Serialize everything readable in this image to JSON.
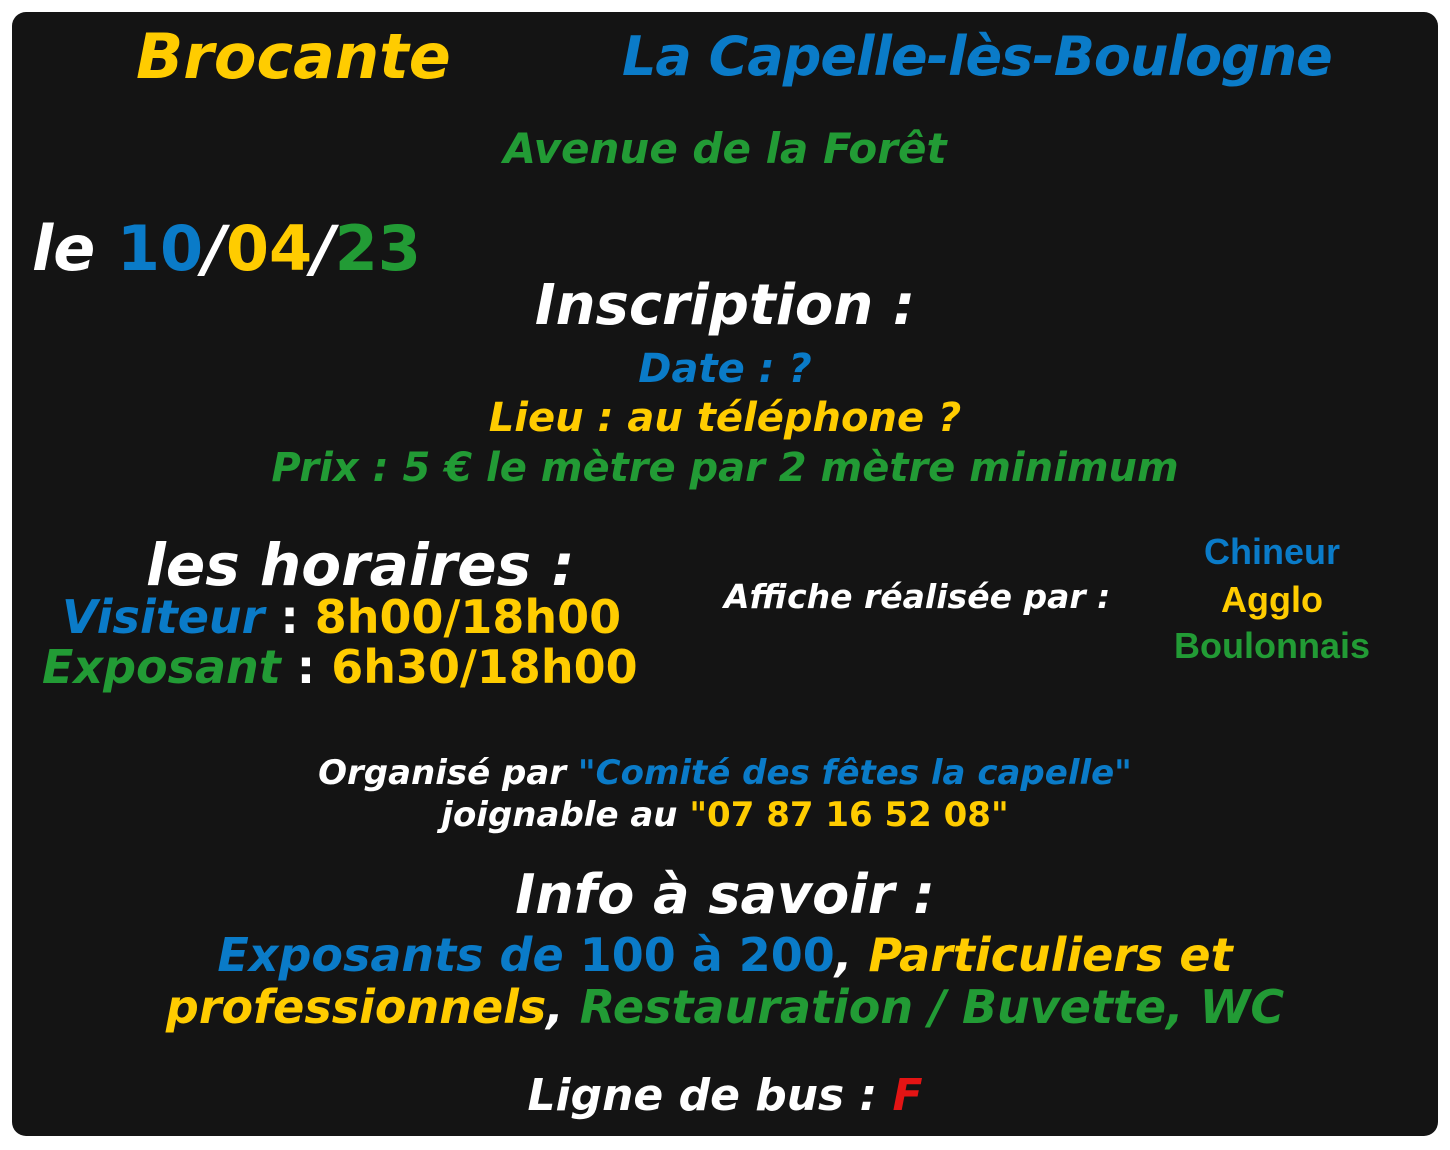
{
  "header": {
    "event": "Brocante",
    "town": "La Capelle-lès-Boulogne",
    "street": "Avenue de la Forêt"
  },
  "date": {
    "prefix": "le ",
    "day": "10",
    "sep1": "/",
    "month": "04",
    "sep2": "/",
    "year": "23"
  },
  "inscription": {
    "title": "Inscription :",
    "date_line": "Date : ?",
    "lieu_line": "Lieu : au téléphone ?",
    "prix_line": "Prix : 5 € le mètre par 2 mètre minimum"
  },
  "horaires": {
    "title": "les horaires :",
    "visitor_label": "Visiteur",
    "visitor_sep": " : ",
    "visitor_time": "8h00/18h00",
    "exhibitor_label": "Exposant",
    "exhibitor_sep": " : ",
    "exhibitor_time": "6h30/18h00"
  },
  "credit": {
    "label": "Affiche réalisée par :",
    "line1": "Chineur",
    "line2": "Agglo",
    "line3": "Boulonnais"
  },
  "organizer": {
    "prefix": "Organisé par ",
    "name": "\"Comité des fêtes la capelle\"",
    "phone_prefix": "joignable au ",
    "phone": "\"07 87 16 52 08\""
  },
  "info": {
    "title": "Info à savoir :",
    "exposants_text": "Exposants de ",
    "exposants_range": "100 à 200",
    "comma1": ", ",
    "particuliers_1": "Particuliers et",
    "particuliers_2": "professionnels",
    "comma2": ", ",
    "services": "Restauration / Buvette, WC"
  },
  "bus": {
    "label": "Ligne de bus : ",
    "line": "F"
  },
  "colors": {
    "yellow": "#ffcc00",
    "blue": "#0a7bc8",
    "green": "#229b35",
    "white": "#ffffff",
    "red": "#e41414",
    "background": "#141414"
  }
}
